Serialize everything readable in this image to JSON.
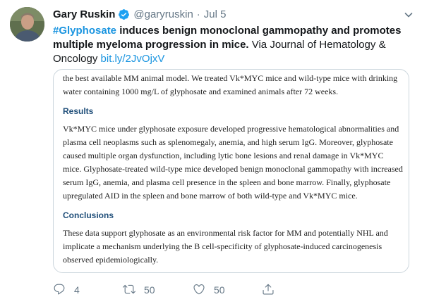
{
  "user": {
    "display_name": "Gary Ruskin",
    "handle": "@garyruskin",
    "separator": "·",
    "time": "Jul 5",
    "verified_icon": "verified-badge-icon",
    "avatar_icon": "user-avatar"
  },
  "tweet": {
    "hashtag": "#Glyphosate",
    "headline": " induces benign monoclonal gammopathy and promotes multiple myeloma progression in mice.",
    "via": "  Via Journal of Hematology & Oncology ",
    "link": "bit.ly/2JvOjxV"
  },
  "paper": {
    "intro": "the best available MM animal model. We treated Vk*MYC mice and wild-type mice with drinking water containing 1000 mg/L of glyphosate and examined animals after 72 weeks.",
    "results_heading": "Results",
    "results_text": "Vk*MYC mice under glyphosate exposure developed progressive hematological abnormalities and plasma cell neoplasms such as splenomegaly, anemia, and high serum IgG. Moreover, glyphosate caused multiple organ dysfunction, including lytic bone lesions and renal damage in Vk*MYC mice. Glyphosate-treated wild-type mice developed benign monoclonal gammopathy with increased serum IgG, anemia, and plasma cell presence in the spleen and bone marrow. Finally, glyphosate upregulated AID in the spleen and bone marrow of both wild-type and Vk*MYC mice.",
    "conclusions_heading": "Conclusions",
    "conclusions_text": "These data support glyphosate as an environmental risk factor for MM and potentially NHL and implicate a mechanism underlying the B cell-specificity of glyphosate-induced carcinogenesis observed epidemiologically."
  },
  "actions": {
    "reply_count": "4",
    "retweet_count": "50",
    "like_count": "50",
    "reply_icon": "reply-icon",
    "retweet_icon": "retweet-icon",
    "like_icon": "heart-icon",
    "share_icon": "share-icon"
  },
  "colors": {
    "link": "#1b95e0",
    "muted": "#657786",
    "heading": "#1f4e79"
  }
}
